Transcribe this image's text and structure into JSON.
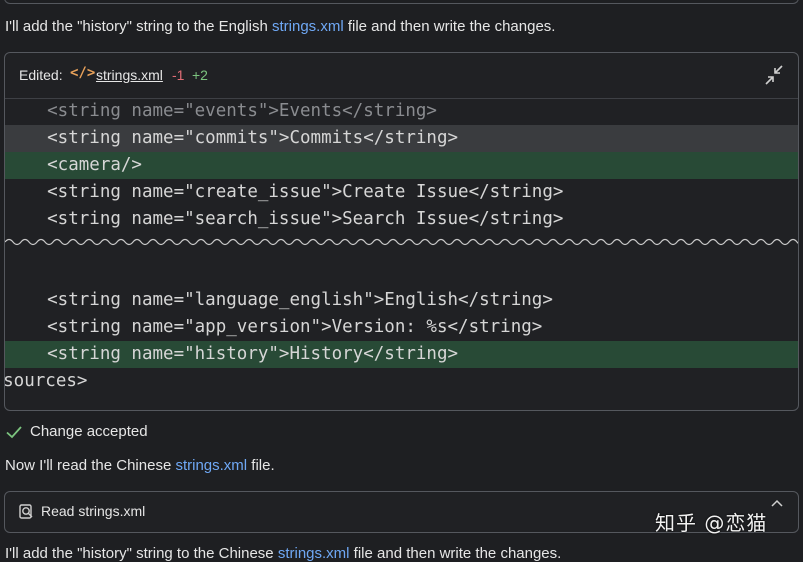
{
  "messages": {
    "intro_prefix": "I'll add the \"history\" string to the English ",
    "intro_link": "strings.xml",
    "intro_suffix": " file and then write the changes.",
    "read_prefix": "Now I'll read the Chinese ",
    "read_link": "strings.xml",
    "read_suffix": " file.",
    "bottom_prefix": "I'll add the \"history\" string to the Chinese ",
    "bottom_link": "strings.xml",
    "bottom_suffix": " file and then write the changes."
  },
  "edit_card": {
    "label": "Edited:",
    "file_icon": "code-icon",
    "file_name": "strings.xml",
    "deletions": "-1",
    "additions": "+2",
    "expand_icon": "collapse-arrows-icon",
    "lines": [
      {
        "text": "    <string name=\"events\">Events</string>",
        "state": "faded"
      },
      {
        "text": "    <string name=\"commits\">Commits</string>",
        "state": "removed"
      },
      {
        "text": "    <camera/>",
        "state": "added"
      },
      {
        "text": "    <string name=\"create_issue\">Create Issue</string>",
        "state": "normal"
      },
      {
        "text": "    <string name=\"search_issue\">Search Issue</string>",
        "state": "normal"
      },
      {
        "text": "    <string name=\"language_english\">English</string>",
        "state": "normal"
      },
      {
        "text": "    <string name=\"app_version\">Version: %s</string>",
        "state": "normal"
      },
      {
        "text": "    <string name=\"history\">History</string>",
        "state": "added"
      },
      {
        "text": "</resources>",
        "state": "normal"
      }
    ]
  },
  "status": {
    "icon": "check-icon",
    "text": "Change accepted"
  },
  "read_card": {
    "icon": "read-file-icon",
    "label": "Read strings.xml",
    "chevron": "chevron-up-icon"
  },
  "watermark": "知乎 @恋猫",
  "colors": {
    "background": "#1e1f22",
    "link": "#6fa8f5",
    "added_bg": "#284a36",
    "removed_bg": "#3a3c3f",
    "deletions": "#e06c75",
    "additions": "#7cc47f"
  }
}
